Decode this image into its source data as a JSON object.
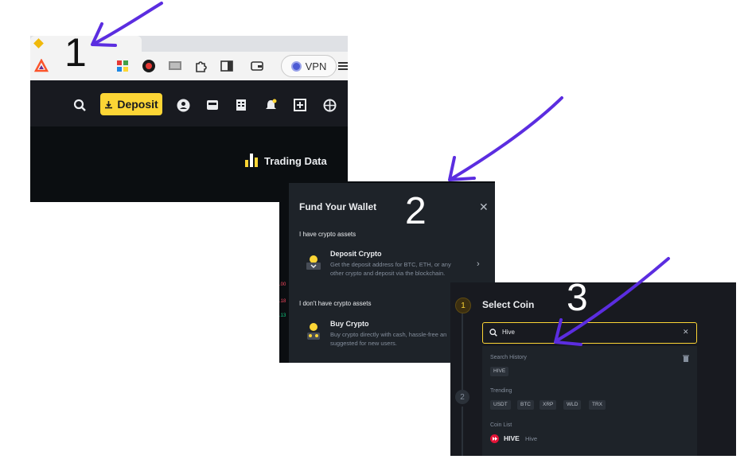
{
  "panel1": {
    "annotation_number": "1",
    "browser": {
      "vpn_label": "VPN"
    },
    "header": {
      "deposit_label": "Deposit"
    },
    "trading_data_label": "Trading Data"
  },
  "panel2": {
    "annotation_number": "2",
    "title": "Fund Your Wallet",
    "close_glyph": "✕",
    "section_have": "I have crypto assets",
    "deposit_crypto": {
      "title": "Deposit Crypto",
      "desc": "Get the deposit address for BTC, ETH, or any other crypto and deposit via the blockchain."
    },
    "section_dont": "I don't have crypto assets",
    "buy_crypto": {
      "title": "Buy Crypto",
      "desc": "Buy crypto directly with cash, hassle-free an suggested for new users."
    },
    "edge_numbers": [
      ".00",
      ".18",
      ".13"
    ]
  },
  "panel3": {
    "annotation_number": "3",
    "step1": "1",
    "step2": "2",
    "title": "Select Coin",
    "search_value": "Hive",
    "clear_glyph": "✕",
    "search_history_label": "Search History",
    "history_chips": [
      "HIVE"
    ],
    "trending_label": "Trending",
    "trending_chips": [
      "USDT",
      "BTC",
      "XRP",
      "WLD",
      "TRX"
    ],
    "coin_list_label": "Coin List",
    "coin": {
      "symbol": "HIVE",
      "name": "Hive"
    }
  },
  "colors": {
    "arrow": "#5b2de0",
    "accent": "#fcd535",
    "dark_bg": "#181a20"
  }
}
